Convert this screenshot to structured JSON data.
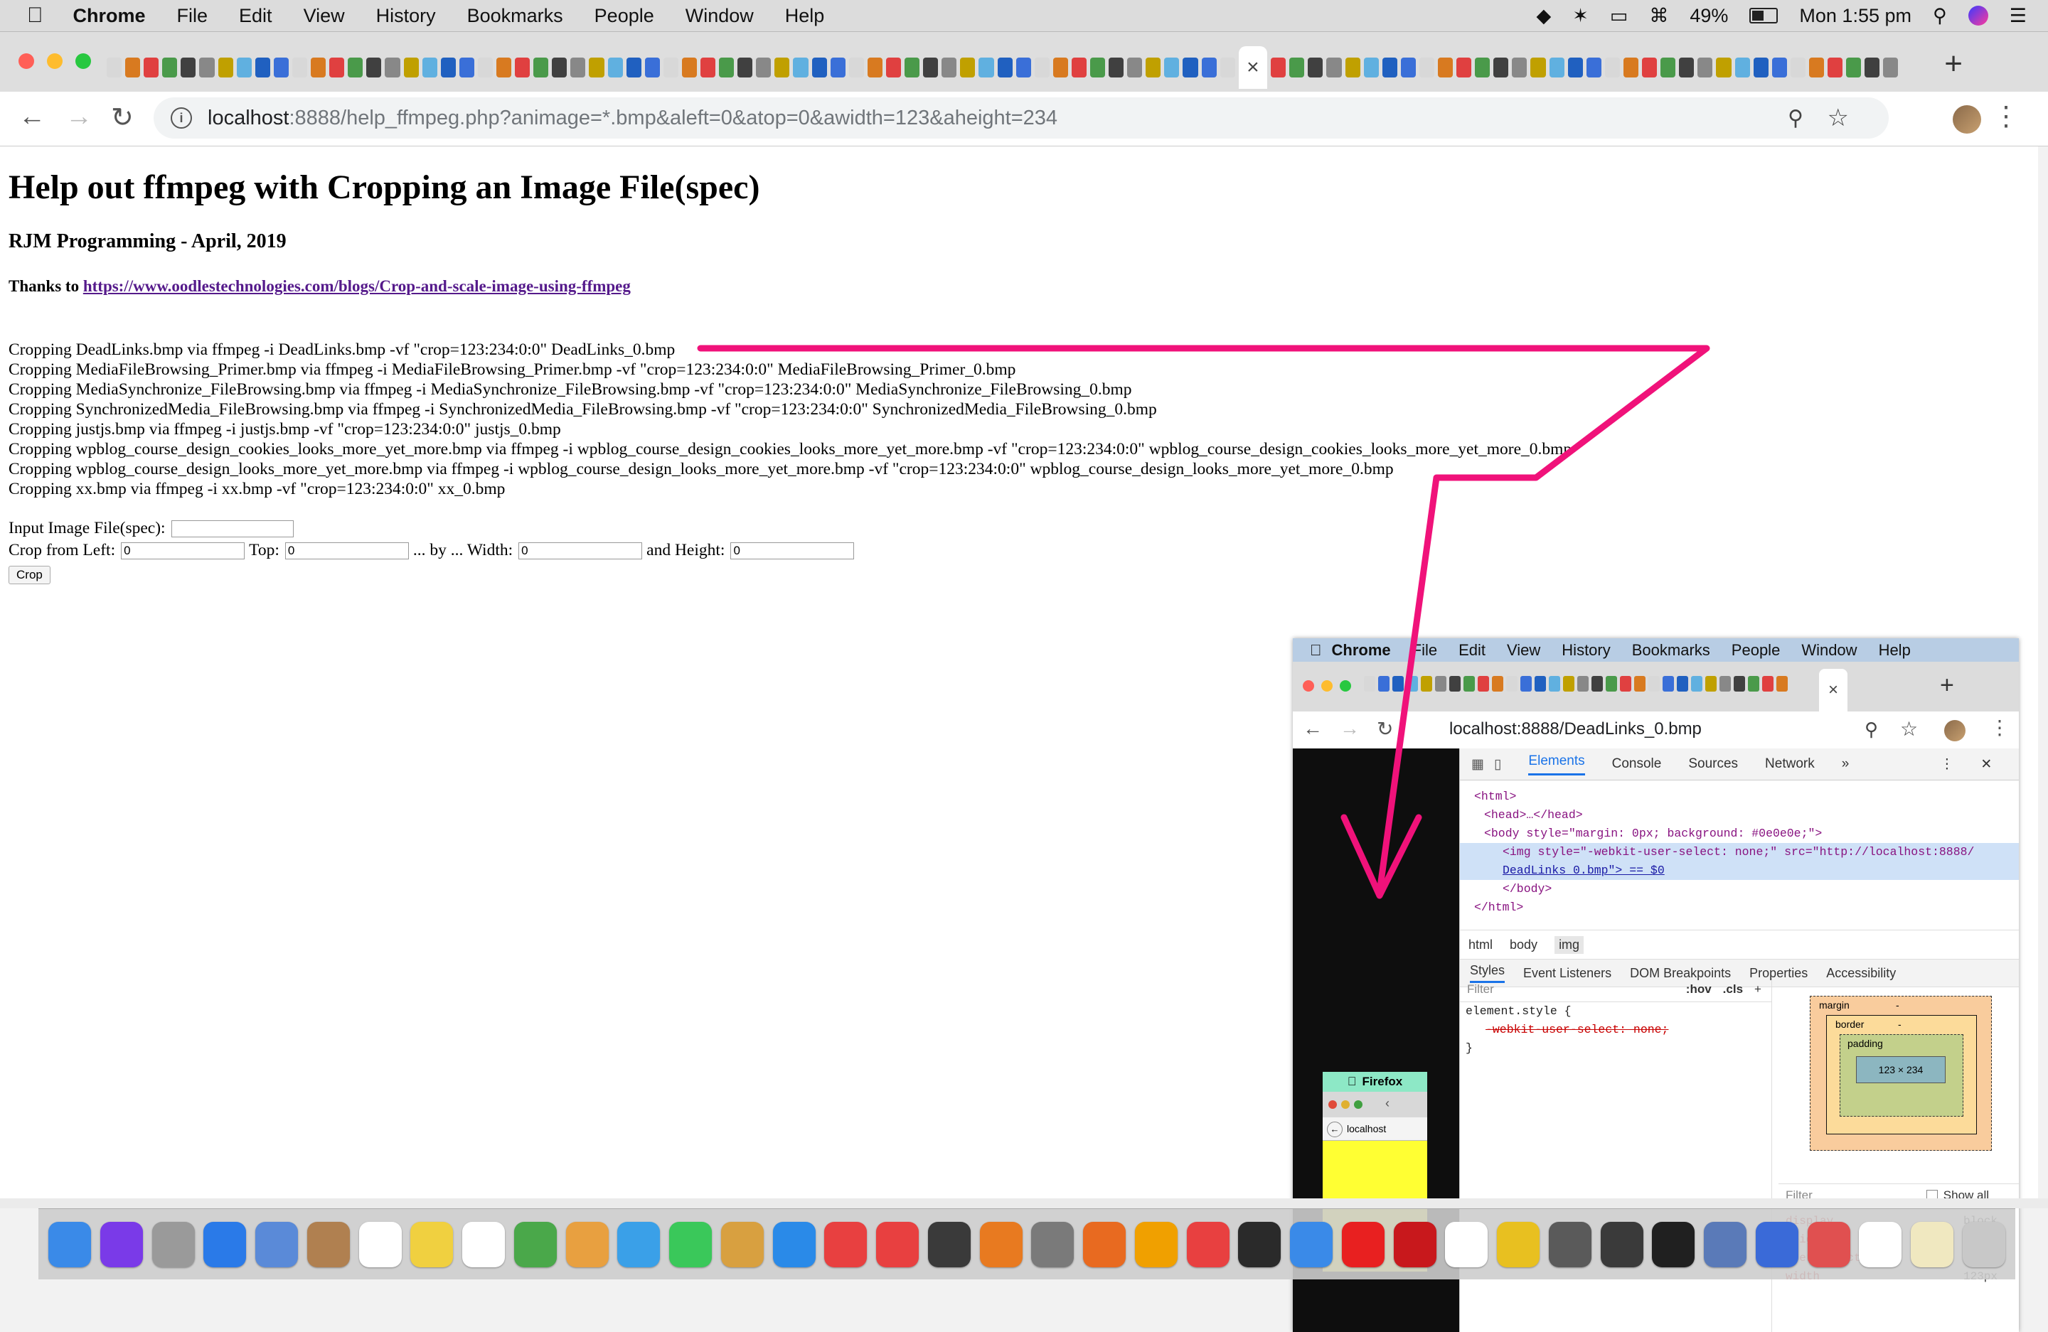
{
  "menubar": {
    "apple": "",
    "app_name": "Chrome",
    "items": [
      "File",
      "Edit",
      "View",
      "History",
      "Bookmarks",
      "People",
      "Window",
      "Help"
    ],
    "battery": "49%",
    "clock": "Mon 1:55 pm"
  },
  "browser": {
    "close_tab": "×",
    "new_tab": "+",
    "url_host": "localhost",
    "url_rest": ":8888/help_ffmpeg.php?animage=*.bmp&aleft=0&atop=0&awidth=123&aheight=234"
  },
  "page": {
    "title": "Help out ffmpeg with Cropping an Image File(spec)",
    "byline": "RJM Programming - April, 2019",
    "thanks_label": "Thanks to ",
    "thanks_link": "https://www.oodlestechnologies.com/blogs/Crop-and-scale-image-using-ffmpeg",
    "crop_lines": [
      "Cropping DeadLinks.bmp via ffmpeg -i DeadLinks.bmp -vf \"crop=123:234:0:0\" DeadLinks_0.bmp",
      "Cropping MediaFileBrowsing_Primer.bmp via ffmpeg -i MediaFileBrowsing_Primer.bmp -vf \"crop=123:234:0:0\" MediaFileBrowsing_Primer_0.bmp",
      "Cropping MediaSynchronize_FileBrowsing.bmp via ffmpeg -i MediaSynchronize_FileBrowsing.bmp -vf \"crop=123:234:0:0\" MediaSynchronize_FileBrowsing_0.bmp",
      "Cropping SynchronizedMedia_FileBrowsing.bmp via ffmpeg -i SynchronizedMedia_FileBrowsing.bmp -vf \"crop=123:234:0:0\" SynchronizedMedia_FileBrowsing_0.bmp",
      "Cropping justjs.bmp via ffmpeg -i justjs.bmp -vf \"crop=123:234:0:0\" justjs_0.bmp",
      "Cropping wpblog_course_design_cookies_looks_more_yet_more.bmp via ffmpeg -i wpblog_course_design_cookies_looks_more_yet_more.bmp -vf \"crop=123:234:0:0\" wpblog_course_design_cookies_looks_more_yet_more_0.bmp",
      "Cropping wpblog_course_design_looks_more_yet_more.bmp via ffmpeg -i wpblog_course_design_looks_more_yet_more.bmp -vf \"crop=123:234:0:0\" wpblog_course_design_looks_more_yet_more_0.bmp",
      "Cropping xx.bmp via ffmpeg -i xx.bmp -vf \"crop=123:234:0:0\" xx_0.bmp"
    ],
    "form": {
      "input_label": "Input Image File(spec):",
      "input_value": "",
      "left_label": "Crop from Left:",
      "left_value": "0",
      "top_label": "Top:",
      "top_value": "0",
      "width_label": "... by ... Width:",
      "width_value": "0",
      "height_label": "and Height:",
      "height_value": "0",
      "crop_button": "Crop"
    }
  },
  "inset": {
    "menubar": {
      "app_name": "Chrome",
      "items": [
        "File",
        "Edit",
        "View",
        "History",
        "Bookmarks",
        "People",
        "Window",
        "Help"
      ]
    },
    "close_tab": "×",
    "new_tab": "+",
    "url": "localhost:8888/DeadLinks_0.bmp",
    "thumb_title": "Firefox",
    "thumb_url": "localhost",
    "devtools": {
      "tabs": [
        "Elements",
        "Console",
        "Sources",
        "Network",
        "»"
      ],
      "code": {
        "html_open": "<html>",
        "head": "<head>…</head>",
        "body_open": "<body style=\"margin: 0px; background: #0e0e0e;\">",
        "img_line_1": "<img style=\"-webkit-user-select: none;\" src=\"http://localhost:8888/",
        "img_line_2": "DeadLinks_0.bmp\"> == $0",
        "body_close": "</body>",
        "html_close": "</html>"
      },
      "crumbs": [
        "html",
        "body",
        "img"
      ],
      "subtabs": [
        "Styles",
        "Event Listeners",
        "DOM Breakpoints",
        "Properties",
        "Accessibility"
      ],
      "filter": "Filter",
      "hov": ":hov",
      "cls": ".cls",
      "rule_selector": "element.style {",
      "rule_prop": "-webkit-user-select: none;",
      "rule_close": "}",
      "box": {
        "margin": "margin",
        "border": "border",
        "padding": "padding",
        "dash": "-",
        "size": "123 × 234"
      },
      "computed_filter": "Filter",
      "show_all": "Show all",
      "computed": [
        {
          "prop": "display",
          "val": "block"
        },
        {
          "prop": "height",
          "val": "234px"
        },
        {
          "prop": "user-select",
          "val": "none"
        },
        {
          "prop": "width",
          "val": "123px"
        }
      ]
    }
  },
  "colors": {
    "arrow": "#f0127a",
    "link": "#551a8b",
    "inset_menubar": "#b8cde4",
    "thumb_yellow": "#ffff33",
    "inset_viewport": "#0e0e0e"
  }
}
